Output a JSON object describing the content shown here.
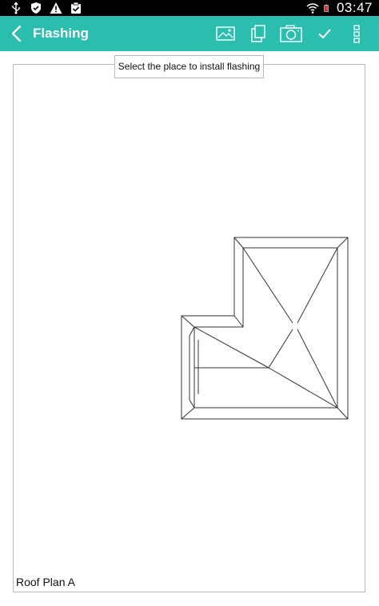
{
  "status_bar": {
    "time": "03:47",
    "left_icons": [
      "usb-icon",
      "shield-icon",
      "warning-icon",
      "clipboard-check-icon"
    ],
    "right_icons": [
      "wifi-icon",
      "battery-icon"
    ]
  },
  "app_bar": {
    "title": "Flashing",
    "actions": [
      "image-icon",
      "copy-pages-icon",
      "camera-icon",
      "check-icon",
      "more-vert-icon"
    ],
    "accent_color": "#2bbdae"
  },
  "canvas": {
    "instruction": "Select the place to install flashing",
    "plan_label": "Roof Plan A"
  }
}
